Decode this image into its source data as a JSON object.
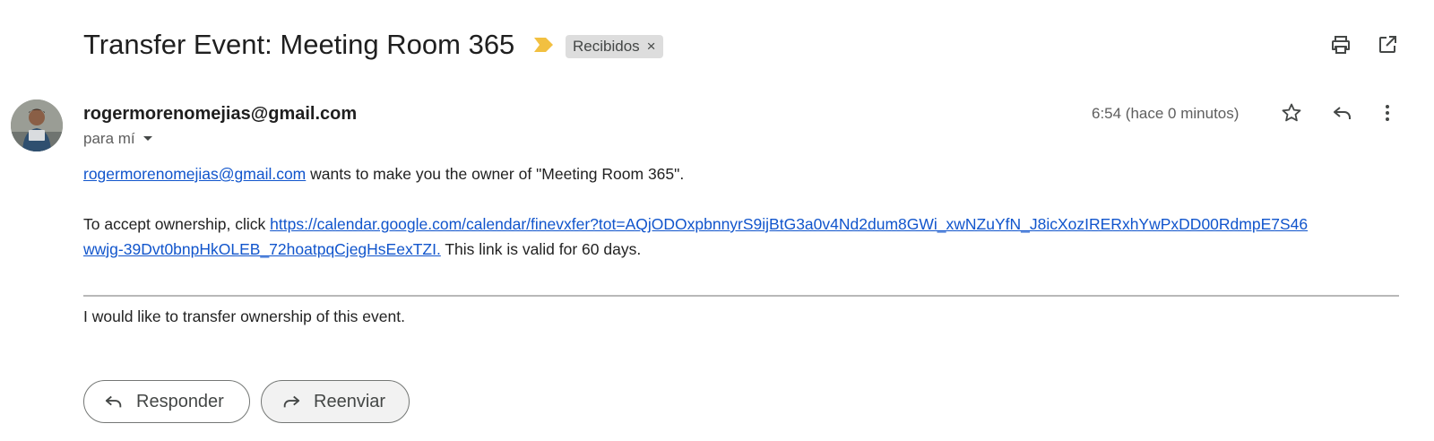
{
  "email": {
    "subject": "Transfer Event: Meeting Room 365",
    "label": "Recibidos",
    "label_remove": "×",
    "sender": "rogermorenomejias@gmail.com",
    "recipient_text": "para mí",
    "timestamp": "6:54 (hace 0 minutos)",
    "body": {
      "line1_link": "rogermorenomejias@gmail.com",
      "line1_text": " wants to make you the owner of \"Meeting Room 365\".",
      "line2_prefix": "To accept ownership, click ",
      "accept_link_part1": "https://calendar.google.com/calendar/finevxfer?tot=AQjODOxpbnnyrS9ijBtG3a0v4Nd2dum8GWi_xwNZuYfN_J8icXozIRERxhYwPxDD00RdmpE7S46",
      "accept_link_part2": "wwjg-39Dvt0bnpHkOLEB_72hoatpqCjegHsEexTZI.",
      "line2_suffix": " This link is valid for 60 days.",
      "message": "I would like to transfer ownership of this event."
    }
  },
  "actions": {
    "reply_label": "Responder",
    "forward_label": "Reenviar"
  },
  "icons": {
    "important": "important-marker-icon",
    "print": "print-icon",
    "open_new_window": "open-in-new-icon",
    "star": "star-icon",
    "reply": "reply-icon",
    "more": "more-vert-icon",
    "forward": "forward-icon",
    "dropdown": "arrow-drop-down-icon"
  },
  "colors": {
    "important_marker": "#f2c041",
    "link": "#1155cc",
    "label_chip_bg": "#dddddd"
  }
}
